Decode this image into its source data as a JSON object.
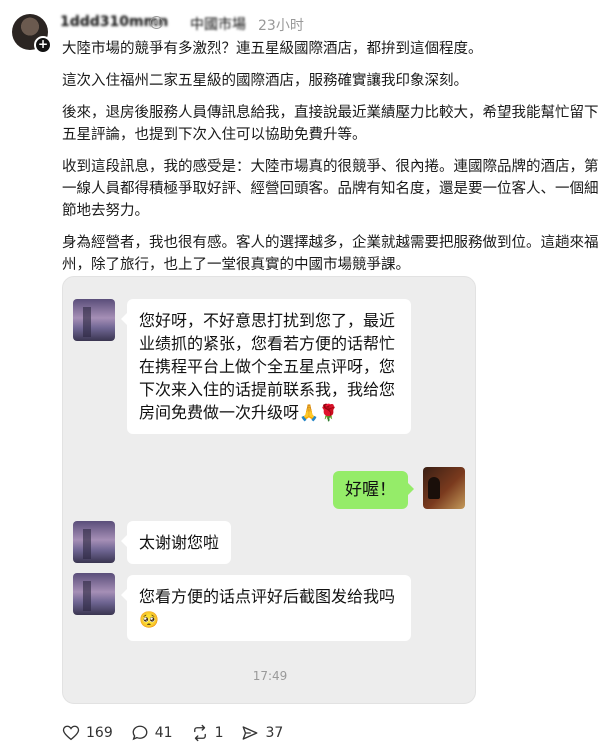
{
  "header": {
    "username": "1ddd310mmn",
    "topic_separator": "○",
    "topic": "中國市場",
    "time": "23小时"
  },
  "post": {
    "paragraphs": [
      "大陸市場的競爭有多激烈？連五星級國際酒店，都拚到這個程度。",
      "這次入住福州二家五星級的國際酒店，服務確實讓我印象深刻。",
      "後來，退房後服務人員傳訊息給我，直接說最近業績壓力比較大，希望我能幫忙留下五星評論，也提到下次入住可以協助免費升等。",
      "收到這段訊息，我的感受是：大陸市場真的很競爭、很內捲。連國際品牌的酒店，第一線人員都得積極爭取好評、經營回頭客。品牌有知名度，還是要一位客人、一個細節地去努力。",
      "身為經營者，我也很有感。客人的選擇越多，企業就越需要把服務做到位。這趟來福州，除了旅行，也上了一堂很真實的中國市場競爭課。"
    ]
  },
  "chat": {
    "messages": [
      {
        "from": "hotel",
        "text": "您好呀，不好意思打扰到您了，最近业绩抓的紧张，您看若方便的话帮忙在携程平台上做个全五星点评呀，您下次来入住的话提前联系我，我给您房间免费做一次升级呀🙏🌹"
      },
      {
        "from": "me",
        "text": "好喔！"
      },
      {
        "from": "hotel",
        "text": "太谢谢您啦"
      },
      {
        "from": "hotel",
        "text": "您看方便的话点评好后截图发给我吗🥺"
      }
    ],
    "time": "17:49"
  },
  "actions": {
    "likes": "169",
    "comments": "41",
    "reposts": "1",
    "shares": "37"
  },
  "colors": {
    "green_bubble": "#95ec69",
    "chat_bg": "#ededed"
  }
}
